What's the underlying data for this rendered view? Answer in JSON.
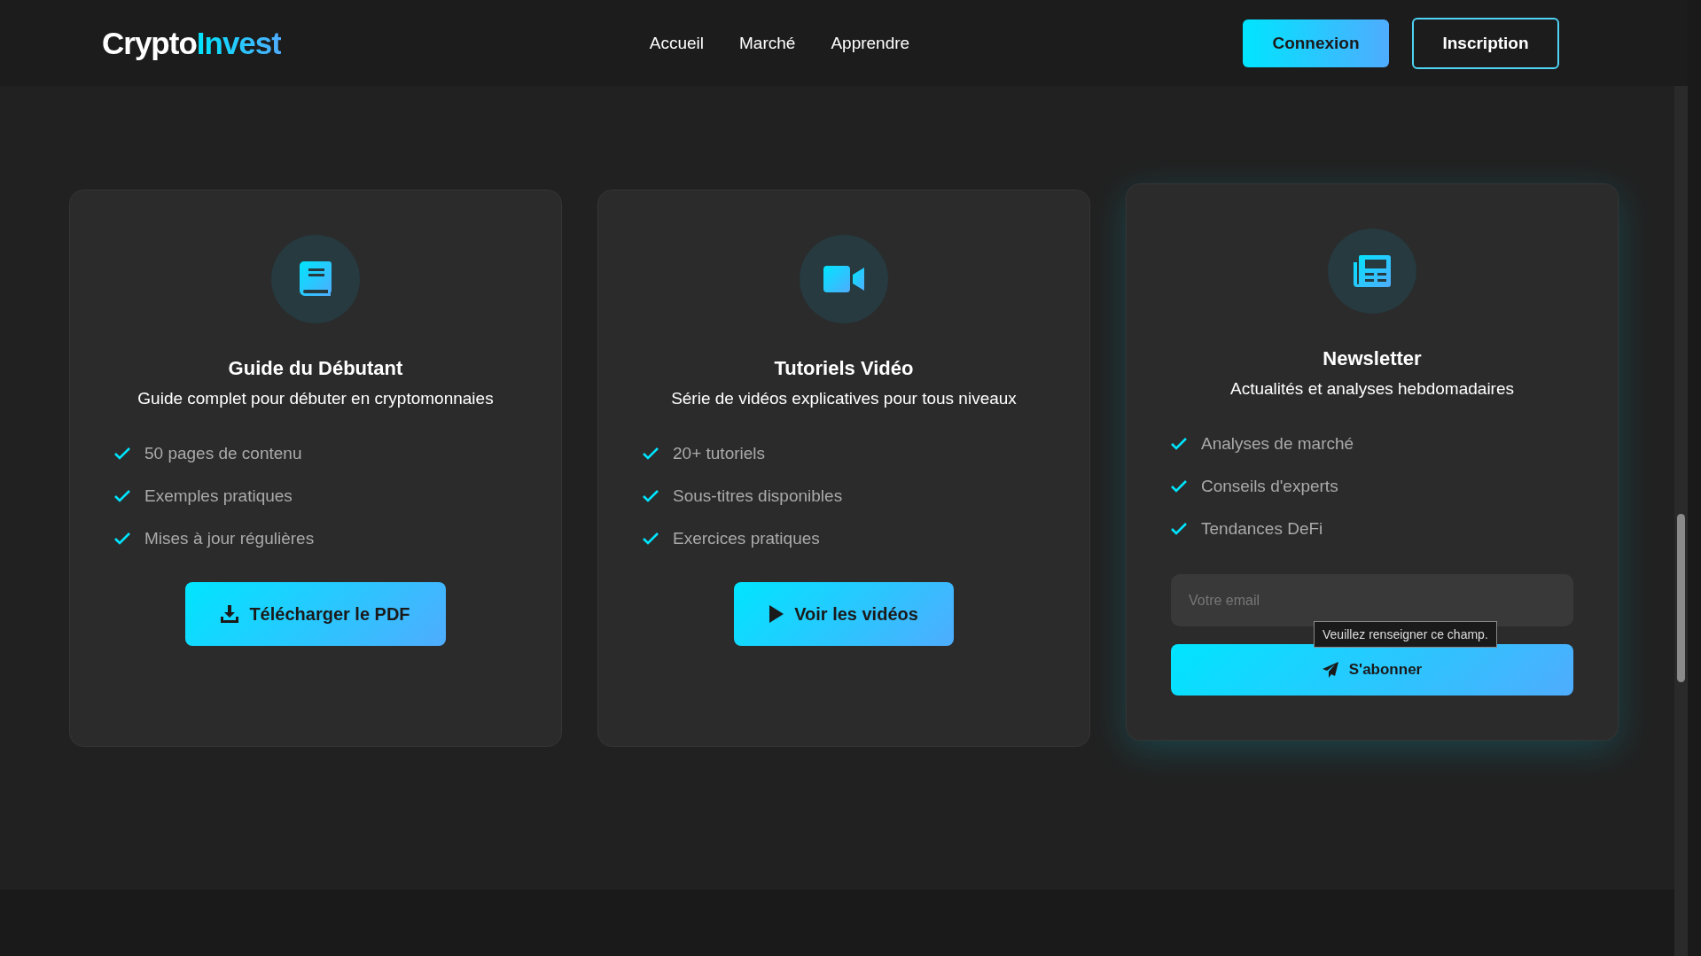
{
  "header": {
    "logo": {
      "text": "Crypto",
      "accent": "Invest"
    },
    "nav": [
      {
        "label": "Accueil"
      },
      {
        "label": "Marché"
      },
      {
        "label": "Apprendre"
      }
    ],
    "actions": [
      {
        "label": "Connexion",
        "kind": "filled"
      },
      {
        "label": "Inscription",
        "kind": "outline"
      }
    ]
  },
  "section": {
    "cards": [
      {
        "kind": "guide",
        "raised": false,
        "title": "Guide du Débutant",
        "subtitle": "Guide complet pour débuter en cryptomonnaies",
        "features": [
          "50 pages de contenu",
          "Exemples pratiques",
          "Mises à jour régulières"
        ],
        "button": {
          "label": "Télécharger le PDF"
        }
      },
      {
        "kind": "video",
        "raised": false,
        "title": "Tutoriels Vidéo",
        "subtitle": "Série de vidéos explicatives pour tous niveaux",
        "features": [
          "20+ tutoriels",
          "Sous-titres disponibles",
          "Exercices pratiques"
        ],
        "button": {
          "label": "Voir les vidéos"
        }
      },
      {
        "kind": "newsletter",
        "raised": true,
        "title": "Newsletter",
        "subtitle": "Actualités et analyses hebdomadaires",
        "features": [
          "Analyses de marché",
          "Conseils d'experts",
          "Tendances DeFi"
        ],
        "email": {
          "placeholder": "Votre email",
          "tooltip": "Veuillez renseigner ce champ."
        },
        "button": {
          "label": "S'abonner"
        }
      }
    ]
  }
}
